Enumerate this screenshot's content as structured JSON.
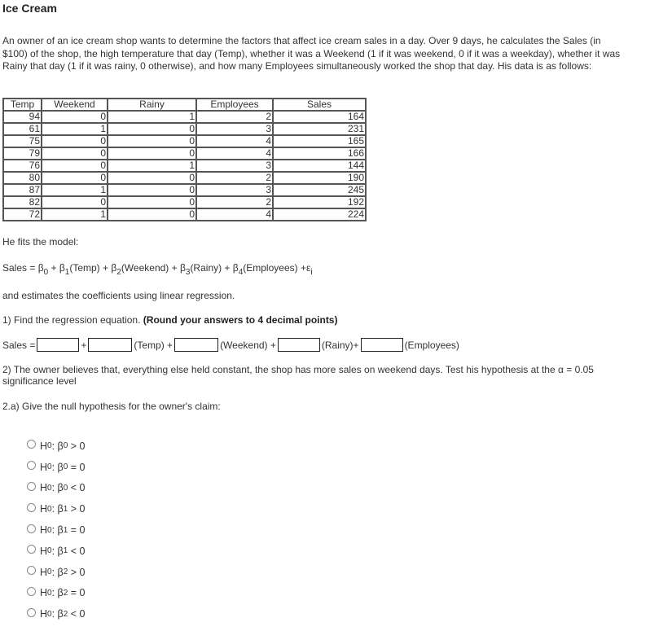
{
  "title": "Ice Cream",
  "intro": "An owner of an ice cream shop wants to determine the factors that affect ice cream sales in a day.  Over 9 days, he calculates the Sales (in $100) of the shop, the high temperature that day (Temp), whether it was a Weekend (1 if it was weekend, 0 if it was a weekday),  whether it was Rainy that day (1 if it was rainy, 0 otherwise), and how many Employees simultaneously worked the shop that day.  His data is as follows:",
  "table": {
    "headers": [
      "Temp",
      "Weekend",
      "Rainy",
      "Employees",
      "Sales"
    ],
    "rows": [
      [
        "94",
        "0",
        "1",
        "2",
        "164"
      ],
      [
        "61",
        "1",
        "0",
        "3",
        "231"
      ],
      [
        "75",
        "0",
        "0",
        "4",
        "165"
      ],
      [
        "79",
        "0",
        "0",
        "4",
        "166"
      ],
      [
        "76",
        "0",
        "1",
        "3",
        "144"
      ],
      [
        "80",
        "0",
        "0",
        "2",
        "190"
      ],
      [
        "87",
        "1",
        "0",
        "3",
        "245"
      ],
      [
        "82",
        "0",
        "0",
        "2",
        "192"
      ],
      [
        "72",
        "1",
        "0",
        "4",
        "224"
      ]
    ]
  },
  "fits_text": "He fits the model:",
  "model": {
    "lhs": "Sales = ",
    "beta": "β",
    "t0": " + ",
    "t1": "(Temp) + ",
    "t2": "(Weekend) + ",
    "t3": "(Rainy) + ",
    "t4": "(Employees) +ε",
    "sub0": "0",
    "sub1": "1",
    "sub2": "2",
    "sub3": "3",
    "sub4": "4",
    "subi": "i"
  },
  "estimates_text": "and estimates the coefficients using linear regression.",
  "q1": {
    "prefix": "1) Find the regression equation. ",
    "bold": "(Round your answers to 4 decimal points)"
  },
  "equation": {
    "lhs": "Sales =",
    "plus": "+",
    "temp": "(Temp) +",
    "weekend": "(Weekend) +",
    "rainy": "(Rainy)+",
    "employees": "(Employees)",
    "inputs": [
      "",
      "",
      "",
      "",
      ""
    ]
  },
  "q2": "2) The owner believes that, everything else held constant, the shop has more sales on weekend days.  Test his hypothesis at the α = 0.05 significance level",
  "q2a": "2.a) Give the null hypothesis for the owner's claim:",
  "options": [
    {
      "h": "H",
      "hsub": "0",
      "sep": ": ",
      "beta": "β",
      "bsub": "0",
      "rel": " > 0"
    },
    {
      "h": "H",
      "hsub": "0",
      "sep": ": ",
      "beta": "β",
      "bsub": "0",
      "rel": " = 0"
    },
    {
      "h": "H",
      "hsub": "0",
      "sep": ": ",
      "beta": "β",
      "bsub": "0",
      "rel": " < 0"
    },
    {
      "h": "H",
      "hsub": "0",
      "sep": ": ",
      "beta": "β",
      "bsub": "1",
      "rel": " > 0"
    },
    {
      "h": "H",
      "hsub": "0",
      "sep": ": ",
      "beta": "β",
      "bsub": "1",
      "rel": " = 0"
    },
    {
      "h": "H",
      "hsub": "0",
      "sep": ": ",
      "beta": "β",
      "bsub": "1",
      "rel": " < 0"
    },
    {
      "h": "H",
      "hsub": "0",
      "sep": ": ",
      "beta": "β",
      "bsub": "2",
      "rel": " > 0"
    },
    {
      "h": "H",
      "hsub": "0",
      "sep": ": ",
      "beta": "β",
      "bsub": "2",
      "rel": " = 0"
    },
    {
      "h": "H",
      "hsub": "0",
      "sep": ": ",
      "beta": "β",
      "bsub": "2",
      "rel": " < 0"
    }
  ]
}
